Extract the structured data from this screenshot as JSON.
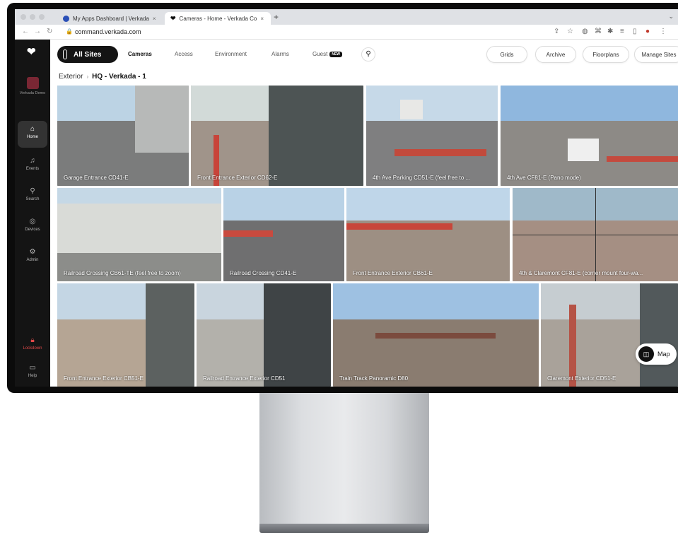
{
  "browser": {
    "tabs": [
      {
        "title": "My Apps Dashboard | Verkada"
      },
      {
        "title": "Cameras - Home - Verkada Co"
      }
    ],
    "tab_close": "×",
    "new_tab": "+",
    "url": "command.verkada.com"
  },
  "sidebar": {
    "org_name": "Verkada Demo",
    "items": [
      {
        "label": "Home",
        "icon": "home-icon"
      },
      {
        "label": "Events",
        "icon": "bell-icon"
      },
      {
        "label": "Search",
        "icon": "search-icon"
      },
      {
        "label": "Devices",
        "icon": "devices-icon"
      },
      {
        "label": "Admin",
        "icon": "gear-icon"
      },
      {
        "label": "Lockdown",
        "icon": "lock-icon"
      },
      {
        "label": "Help",
        "icon": "chat-icon"
      }
    ]
  },
  "topnav": {
    "sites_label": "All Sites",
    "links": [
      "Cameras",
      "Access",
      "Environment",
      "Alarms",
      "Guest"
    ],
    "new_badge": "NEW",
    "right_buttons": [
      "Grids",
      "Archive",
      "Floorplans",
      "Manage Sites"
    ]
  },
  "breadcrumb": {
    "parent": "Exterior",
    "current": "HQ - Verkada - 1"
  },
  "cameras": [
    "Garage Entrance CD41-E",
    "Front Entrance Exterior CD62-E",
    "4th Ave Parking CD51-E (feel free to ...",
    "4th Ave CF81-E (Pano mode)",
    "Railroad Crossing CB61-TE (feel free to zoom)",
    "Railroad Crossing CD41-E",
    "Front Entrance Exterior CB61-E",
    "4th & Claremont CF81-E (corner mount four-wa...",
    "Front Entrance Exterior CB51-E",
    "Railroad Entrance Exterior CD51",
    "Train Track Panoramic D80",
    "Claremont Exterior CD51-E"
  ],
  "map_button": "Map",
  "colors": {
    "accent": "#141414",
    "lockdown": "#e14848",
    "org_avatar": "#7a2734"
  }
}
